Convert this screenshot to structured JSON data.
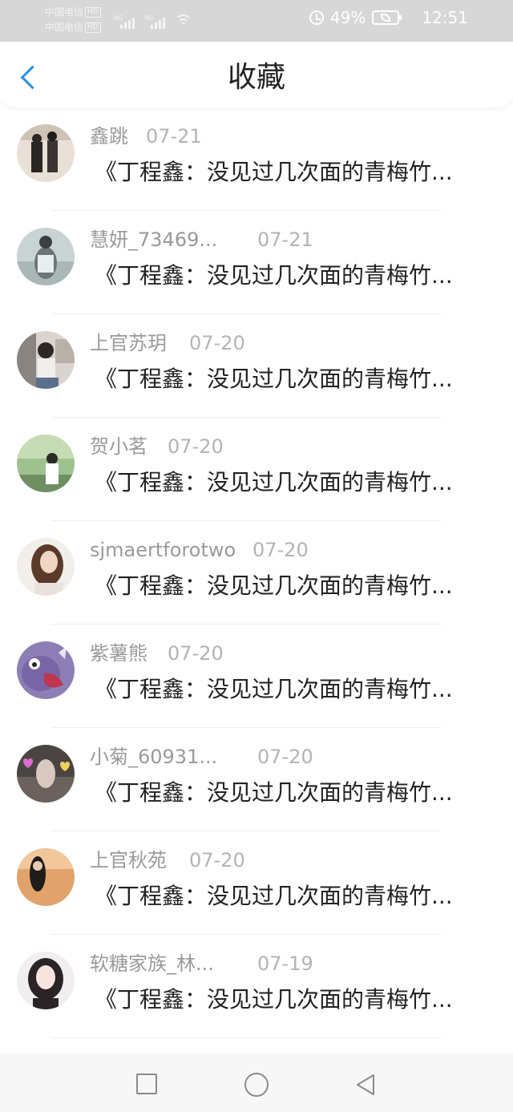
{
  "status_bar": {
    "carrier_1": "中国电信",
    "carrier_2": "中国电信",
    "hd_label": "HD",
    "network_1": "4G",
    "network_2": "4G",
    "battery_percent": "49%",
    "time": "12:51"
  },
  "header": {
    "title": "收藏"
  },
  "favorites": [
    {
      "username": "鑫跳",
      "date": "07-21",
      "snippet": "《丁程鑫：没见过几次面的青梅竹..."
    },
    {
      "username": "慧妍_73469...",
      "date": "07-21",
      "snippet": "《丁程鑫：没见过几次面的青梅竹..."
    },
    {
      "username": "上官苏玥",
      "date": "07-20",
      "snippet": "《丁程鑫：没见过几次面的青梅竹..."
    },
    {
      "username": "贺小茗",
      "date": "07-20",
      "snippet": "《丁程鑫：没见过几次面的青梅竹..."
    },
    {
      "username": "sjmaertforotwo",
      "date": "07-20",
      "snippet": "《丁程鑫：没见过几次面的青梅竹..."
    },
    {
      "username": "紫薯熊",
      "date": "07-20",
      "snippet": "《丁程鑫：没见过几次面的青梅竹..."
    },
    {
      "username": "小菊_60931...",
      "date": "07-20",
      "snippet": "《丁程鑫：没见过几次面的青梅竹..."
    },
    {
      "username": "上官秋苑",
      "date": "07-20",
      "snippet": "《丁程鑫：没见过几次面的青梅竹..."
    },
    {
      "username": "软糖家族_林...",
      "date": "07-19",
      "snippet": "《丁程鑫：没见过几次面的青梅竹..."
    }
  ],
  "colors": {
    "accent": "#2b8fe0",
    "status_bar_bg": "#d7d7d7",
    "username": "#9a9a9a",
    "date": "#b4b4b4",
    "title": "#222222"
  }
}
